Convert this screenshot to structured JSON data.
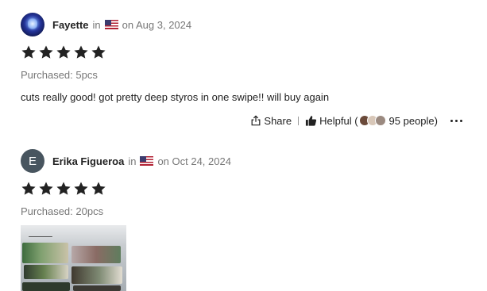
{
  "reviews": [
    {
      "name": "Fayette",
      "in_text": "in",
      "country_flag": "us-flag-icon",
      "date": "on Aug 3, 2024",
      "rating": 5,
      "purchased": "Purchased: 5pcs",
      "text": "cuts really good! got pretty deep styros in one swipe!! will buy again",
      "share_label": "Share",
      "helpful_label": "Helpful (",
      "helpful_count": "95 people",
      "helpful_close": ")",
      "colors": {
        "star": "#222222",
        "meta": "#777777"
      }
    },
    {
      "name": "Erika Figueroa",
      "avatar_letter": "E",
      "in_text": "in",
      "country_flag": "us-flag-icon",
      "date": "on Oct 24, 2024",
      "rating": 5,
      "purchased": "Purchased: 20pcs",
      "colors": {
        "avatar_bg": "#48555f"
      }
    }
  ]
}
